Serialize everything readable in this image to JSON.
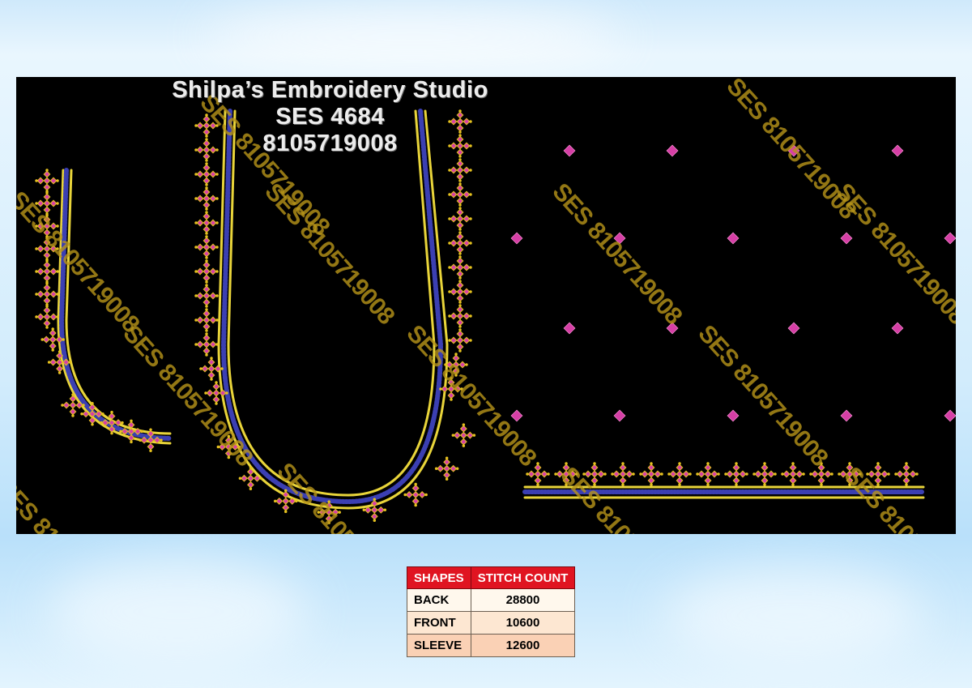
{
  "studio": {
    "name": "Shilpa’s Embroidery Studio",
    "design_code": "SES 4684",
    "phone": "8105719008"
  },
  "watermark": "SES 8105719008",
  "stitch_table": {
    "headers": [
      "SHAPES",
      "STITCH COUNT"
    ],
    "rows": [
      {
        "shape": "BACK",
        "count": "28800"
      },
      {
        "shape": "FRONT",
        "count": "10600"
      },
      {
        "shape": "SLEEVE",
        "count": "12600"
      }
    ]
  },
  "colors": {
    "background": "#000000",
    "thread_gold": "#e8d43a",
    "thread_blue": "#3b3fb2",
    "motif_pink": "#d63fa6",
    "motif_yellow": "#e6c21e",
    "header_red": "#e01421"
  }
}
